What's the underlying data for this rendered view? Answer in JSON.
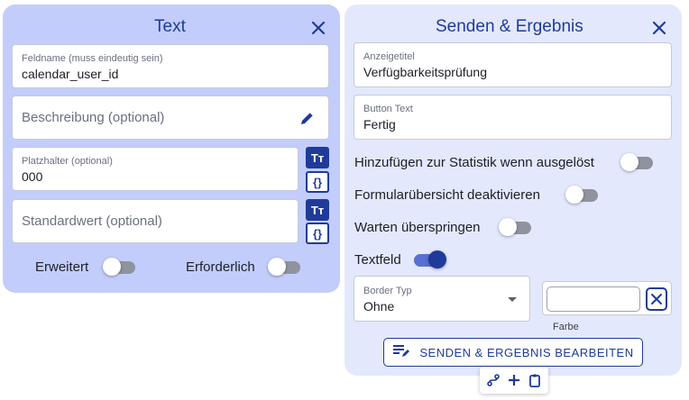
{
  "left_panel": {
    "title": "Text",
    "field_name": {
      "label": "Feldname (muss eindeutig sein)",
      "value": "calendar_user_id"
    },
    "description": {
      "placeholder": "Beschreibung (optional)"
    },
    "placeholder_field": {
      "label": "Platzhalter (optional)",
      "value": "000"
    },
    "default_value": {
      "placeholder": "Standardwert (optional)"
    },
    "toggles": [
      {
        "label": "Erweitert",
        "on": false
      },
      {
        "label": "Erforderlich",
        "on": false
      }
    ],
    "text_format_glyph": "Tт",
    "variable_glyph": "{}"
  },
  "right_panel": {
    "title": "Senden & Ergebnis",
    "display_title": {
      "label": "Anzeigetitel",
      "value": "Verfügbarkeitsprüfung"
    },
    "button_text": {
      "label": "Button Text",
      "value": "Fertig"
    },
    "toggles": [
      {
        "label": "Hinzufügen zur Statistik wenn ausgelöst",
        "on": false
      },
      {
        "label": "Formularübersicht deaktivieren",
        "on": false
      },
      {
        "label": "Warten überspringen",
        "on": false
      },
      {
        "label": "Textfeld",
        "on": true
      }
    ],
    "border_type": {
      "label": "Border Typ",
      "value": "Ohne"
    },
    "color": {
      "caption": "Farbe",
      "value": ""
    },
    "edit_button": {
      "label": "SENDEN & ERGEBNIS BEARBEITEN"
    }
  },
  "colors": {
    "accent": "#1f3b9a",
    "left_panel_bg": "#c3cdfb",
    "right_panel_bg": "#e3e8fd"
  },
  "icons": {
    "close": "close-icon",
    "edit": "pencil-icon",
    "text_format": "text-format-icon",
    "variable": "curly-braces-icon",
    "edit_list": "edit-list-icon",
    "route": "route-icon",
    "add": "plus-icon",
    "clipboard": "clipboard-icon"
  }
}
